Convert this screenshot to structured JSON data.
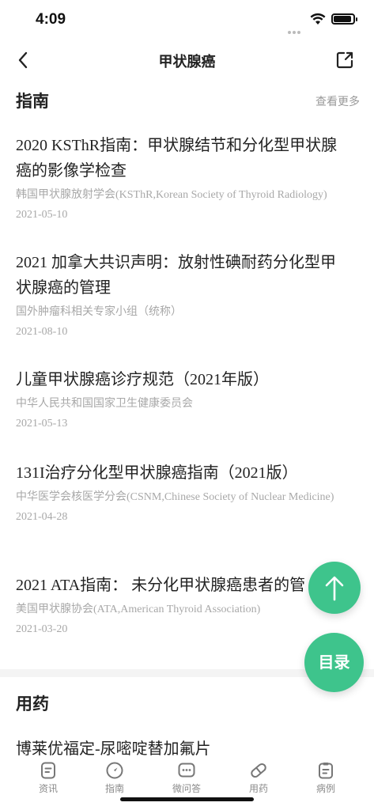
{
  "status_bar": {
    "time": "4:09"
  },
  "nav": {
    "title": "甲状腺癌"
  },
  "guides_section": {
    "title": "指南",
    "more_label": "查看更多"
  },
  "guides": [
    {
      "title": "2020 KSThR指南：甲状腺结节和分化型甲状腺癌的影像学检查",
      "org": "韩国甲状腺放射学会(KSThR,Korean Society of Thyroid Radiology)",
      "date": "2021-05-10"
    },
    {
      "title": "2021 加拿大共识声明：放射性碘耐药分化型甲状腺癌的管理",
      "org": "国外肿瘤科相关专家小组（统称）",
      "date": "2021-08-10"
    },
    {
      "title": "儿童甲状腺癌诊疗规范（2021年版）",
      "org": "中华人民共和国国家卫生健康委员会",
      "date": "2021-05-13"
    },
    {
      "title": "131I治疗分化型甲状腺癌指南（2021版）",
      "org": "中华医学会核医学分会(CSNM,Chinese Society of Nuclear Medicine)",
      "date": "2021-04-28"
    },
    {
      "title": "2021 ATA指南： 未分化甲状腺癌患者的管",
      "org": "美国甲状腺协会(ATA,American Thyroid Association)",
      "date": "2021-03-20"
    }
  ],
  "drugs_section": {
    "title": "用药",
    "first_item": "博莱优福定-尿嘧啶替加氟片"
  },
  "fab": {
    "toc_label": "目录"
  },
  "tabbar": {
    "items": [
      {
        "label": "资讯",
        "icon": "news-icon"
      },
      {
        "label": "指南",
        "icon": "compass-icon"
      },
      {
        "label": "微问答",
        "icon": "chat-icon"
      },
      {
        "label": "用药",
        "icon": "pill-icon"
      },
      {
        "label": "病例",
        "icon": "clipboard-icon"
      }
    ]
  },
  "colors": {
    "accent": "#3ec48c",
    "muted": "#a8a8a8",
    "text": "#222222"
  }
}
